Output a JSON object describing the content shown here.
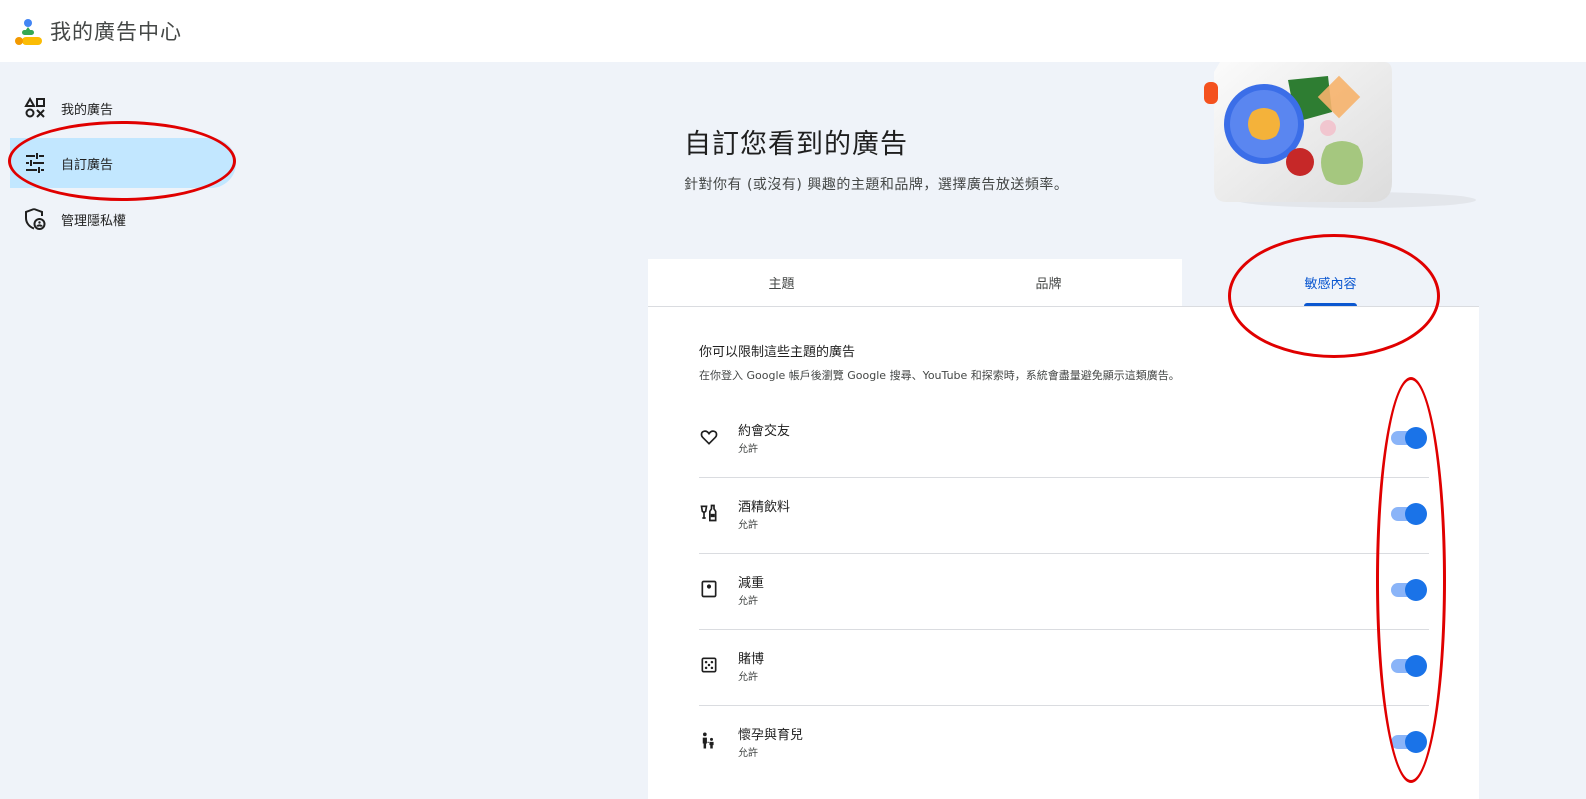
{
  "app": {
    "title": "我的廣告中心"
  },
  "sidebar": {
    "items": [
      {
        "label": "我的廣告",
        "icon": "shapes-icon",
        "active": false
      },
      {
        "label": "自訂廣告",
        "icon": "tune-sliders-icon",
        "active": true
      },
      {
        "label": "管理隱私權",
        "icon": "privacy-shield-icon",
        "active": false
      }
    ]
  },
  "hero": {
    "title": "自訂您看到的廣告",
    "subtitle": "針對你有 (或沒有) 興趣的主題和品牌，選擇廣告放送頻率。"
  },
  "tabs": [
    {
      "label": "主題",
      "active": false
    },
    {
      "label": "品牌",
      "active": false
    },
    {
      "label": "敏感內容",
      "active": true
    }
  ],
  "sensitive": {
    "title": "你可以限制這些主題的廣告",
    "description": "在你登入 Google 帳戶後瀏覽 Google 搜尋、YouTube 和探索時，系統會盡量避免顯示這類廣告。",
    "items": [
      {
        "label": "約會交友",
        "status": "允許",
        "icon": "heart-icon",
        "enabled": true
      },
      {
        "label": "酒精飲料",
        "status": "允許",
        "icon": "liquor-icon",
        "enabled": true
      },
      {
        "label": "減重",
        "status": "允許",
        "icon": "scale-icon",
        "enabled": true
      },
      {
        "label": "賭博",
        "status": "允許",
        "icon": "dice-icon",
        "enabled": true
      },
      {
        "label": "懷孕與育兒",
        "status": "允許",
        "icon": "family-icon",
        "enabled": true
      }
    ]
  },
  "colors": {
    "accent": "#0b57d0",
    "toggle_on": "#1a73e8",
    "active_nav": "#c2e7ff",
    "background": "#eff3f9",
    "annotation": "#e00000"
  }
}
